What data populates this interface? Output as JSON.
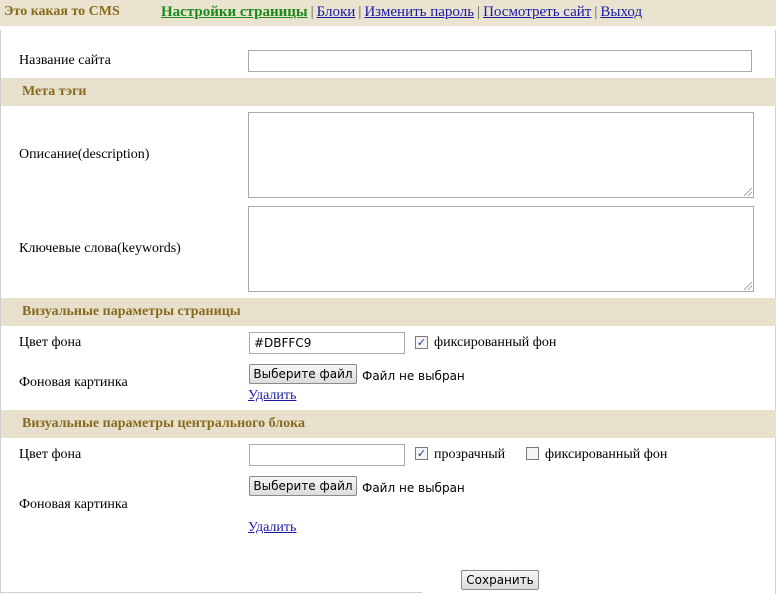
{
  "header": {
    "brand": "Это какая то CMS",
    "nav": [
      {
        "label": "Настройки страницы",
        "active": true
      },
      {
        "label": "Блоки",
        "active": false
      },
      {
        "label": "Изменить пароль",
        "active": false
      },
      {
        "label": "Посмотреть сайт",
        "active": false
      },
      {
        "label": "Выход",
        "active": false
      }
    ],
    "separator": "|"
  },
  "form": {
    "site_name": {
      "label": "Название сайта",
      "value": ""
    },
    "meta_section": "Мета тэги",
    "description": {
      "label": "Описание(description)",
      "value": ""
    },
    "keywords": {
      "label": "Ключевые слова(keywords)",
      "value": ""
    },
    "page_visual_section": "Визуальные параметры страницы",
    "page_bg_color": {
      "label": "Цвет фона",
      "value": "#DBFFC9"
    },
    "page_fixed_bg": {
      "label": "фиксированный фон",
      "checked": true
    },
    "page_bg_image": {
      "label": "Фоновая картинка",
      "button": "Выберите файл",
      "status": "Файл не выбран",
      "delete": "Удалить"
    },
    "block_visual_section": "Визуальные параметры центрального блока",
    "block_bg_color": {
      "label": "Цвет фона",
      "value": ""
    },
    "block_transparent": {
      "label": "прозрачный",
      "checked": true
    },
    "block_fixed_bg": {
      "label": "фиксированный фон",
      "checked": false
    },
    "block_bg_image": {
      "label": "Фоновая картинка",
      "button": "Выберите файл",
      "status": "Файл не выбран",
      "delete": "Удалить"
    },
    "save_label": "Сохранить"
  },
  "colors": {
    "brand": "#8a6a1e",
    "nav_active": "#1a8a1a",
    "link": "#1a1aa6",
    "section_bg": "#e6e0cc",
    "header_bg": "#e9e3d0"
  }
}
